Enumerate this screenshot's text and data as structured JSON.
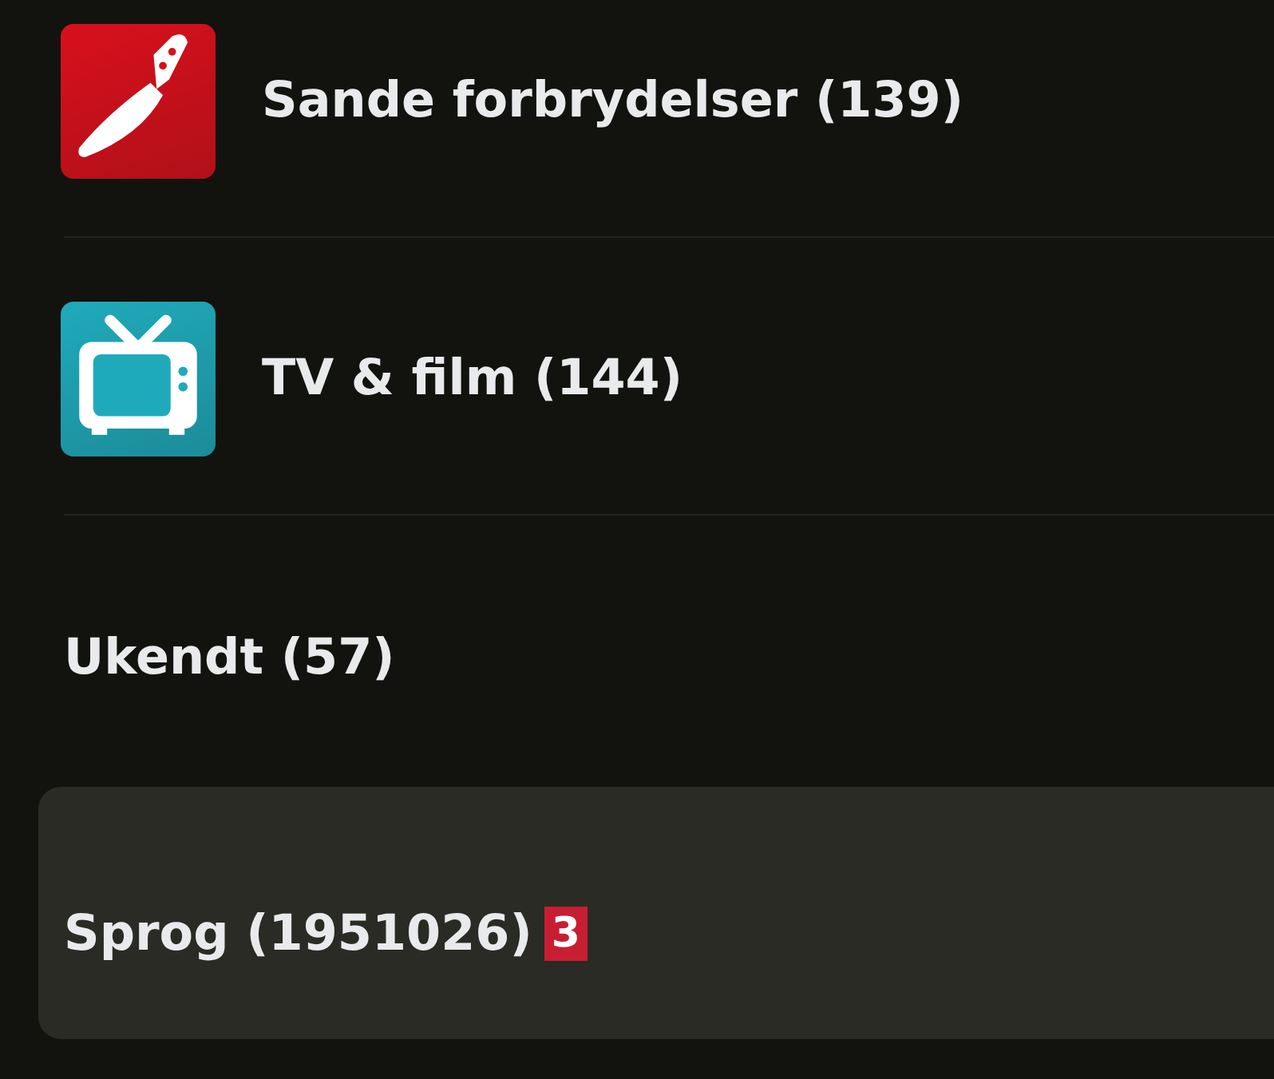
{
  "categories": [
    {
      "kind": "icon",
      "label": "Sande forbrydelser (139)",
      "color": "#d8101c",
      "selected": false
    },
    {
      "kind": "icon",
      "label": "TV & film (144)",
      "color": "#1faabb",
      "selected": false
    },
    {
      "kind": "plain",
      "label": "Ukendt (57)",
      "selected": false
    },
    {
      "kind": "plain",
      "label": "Sprog (1951026)",
      "badge": "3",
      "selected": true
    }
  ]
}
